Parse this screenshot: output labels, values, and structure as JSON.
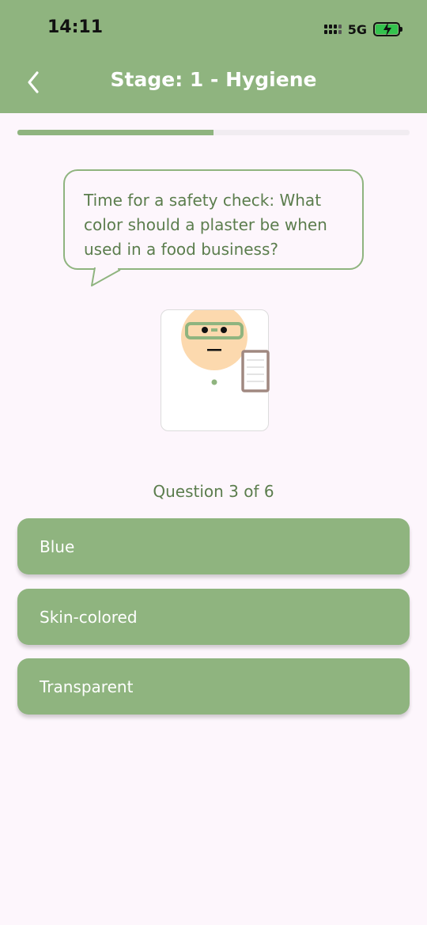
{
  "status_bar": {
    "time": "14:11",
    "network": "5G",
    "battery_state": "charging",
    "battery_level": 1.0
  },
  "header": {
    "title": "Stage: 1 - Hygiene",
    "back_icon": "chevron-left-icon"
  },
  "progress": {
    "fraction": 0.5
  },
  "speech_bubble": {
    "text": "Time for a safety check: What color should a plaster be when used in a food business?"
  },
  "character": {
    "icon": "inspector-character"
  },
  "quiz": {
    "counter": "Question 3 of 6",
    "answers": [
      {
        "label": "Blue"
      },
      {
        "label": "Skin-colored"
      },
      {
        "label": "Transparent"
      }
    ]
  },
  "colors": {
    "primary": "#8fb47f",
    "text_green": "#5b7d4d",
    "background": "#fdf6fc",
    "skin": "#fcd9ae",
    "clipboard": "#a08880"
  }
}
